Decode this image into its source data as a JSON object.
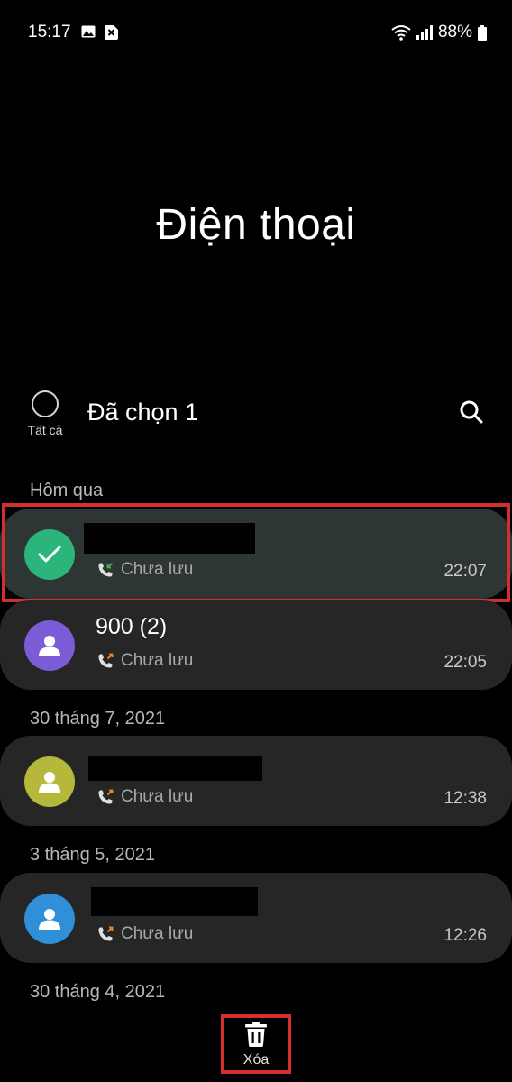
{
  "status_bar": {
    "time": "15:17",
    "battery": "88%"
  },
  "app_title": "Điện thoại",
  "selection": {
    "select_all_label": "Tất cả",
    "selected_count": "Đã chọn 1"
  },
  "sections": [
    {
      "header": "Hôm qua"
    },
    {
      "header": "30 tháng 7, 2021"
    },
    {
      "header": "3 tháng 5, 2021"
    },
    {
      "header": "30 tháng 4, 2021"
    }
  ],
  "calls": [
    {
      "name": "",
      "status": "Chưa lưu",
      "time": "22:07",
      "selected": true,
      "avatar_color": "#2bb57a",
      "call_type": "incoming"
    },
    {
      "name": "900 (2)",
      "status": "Chưa lưu",
      "time": "22:05",
      "selected": false,
      "avatar_color": "#7b5bd6",
      "call_type": "outgoing"
    },
    {
      "name": "",
      "status": "Chưa lưu",
      "time": "12:38",
      "selected": false,
      "avatar_color": "#b5b83a",
      "call_type": "outgoing"
    },
    {
      "name": "",
      "status": "Chưa lưu",
      "time": "12:26",
      "selected": false,
      "avatar_color": "#2f8fd8",
      "call_type": "outgoing"
    }
  ],
  "bottom_bar": {
    "delete_label": "Xóa"
  },
  "colors": {
    "highlight": "#d32f2f",
    "incoming": "#4caf50",
    "outgoing": "#f08a24"
  }
}
